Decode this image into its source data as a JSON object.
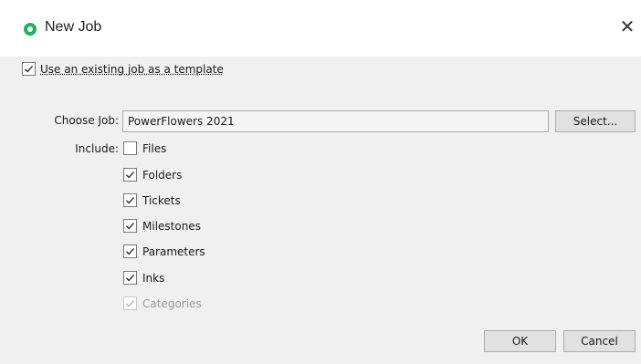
{
  "window": {
    "title": "New Job",
    "close_label": "✕"
  },
  "template_option": {
    "label": "Use an existing job as a template",
    "checked": true
  },
  "choose_job": {
    "label": "Choose Job:",
    "value": "PowerFlowers 2021",
    "select_button": "Select..."
  },
  "include": {
    "label": "Include:",
    "items": [
      {
        "label": "Files",
        "checked": false,
        "enabled": true
      },
      {
        "label": "Folders",
        "checked": true,
        "enabled": true
      },
      {
        "label": "Tickets",
        "checked": true,
        "enabled": true
      },
      {
        "label": "Milestones",
        "checked": true,
        "enabled": true
      },
      {
        "label": "Parameters",
        "checked": true,
        "enabled": true
      },
      {
        "label": "Inks",
        "checked": true,
        "enabled": true
      },
      {
        "label": "Categories",
        "checked": true,
        "enabled": false
      }
    ]
  },
  "buttons": {
    "ok": "OK",
    "cancel": "Cancel"
  },
  "colors": {
    "app_icon": "#1fb15b",
    "checkmark": "#333333",
    "checkmark_disabled": "#b8b8b8"
  }
}
